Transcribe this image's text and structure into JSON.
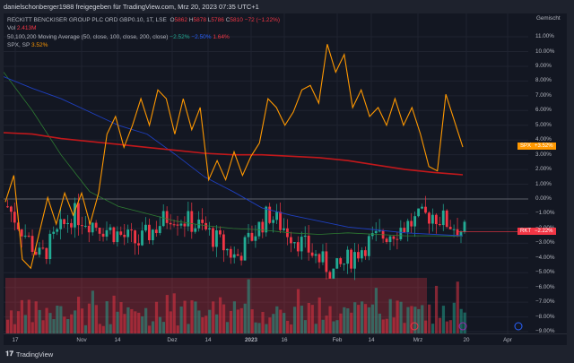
{
  "header": {
    "share_text": "danielschonberger1988 freigegeben für TradingView.com, Mrz 20, 2023 07:35 UTC+1"
  },
  "legend": {
    "symbol": "RECKITT BENCKISER GROUP PLC ORD GBP0.10, 1T, LSE",
    "o_label": "O",
    "o": "5862",
    "h_label": "H",
    "h": "5878",
    "l_label": "L",
    "l": "5786",
    "c_label": "C",
    "c": "5810",
    "change": "−72 (−1.22%)",
    "vol_label": "Vol",
    "vol": "2.413M",
    "ma_label": "50,100,200 Moving Average (50, close, 100, close, 200, close)",
    "ma50": "−2.52%",
    "ma100": "−2.50%",
    "ma200": "1.64%",
    "spx_label": "SPX, SP",
    "spx": "3.52%"
  },
  "scale_label": "Gemischt",
  "y_ticks": [
    "11.00%",
    "10.00%",
    "9.00%",
    "8.00%",
    "7.00%",
    "6.00%",
    "5.00%",
    "4.00%",
    "3.00%",
    "2.00%",
    "1.00%",
    "0.00%",
    "−1.00%",
    "−2.00%",
    "−3.00%",
    "−4.00%",
    "−5.00%",
    "−6.00%",
    "−7.00%",
    "−8.00%",
    "−9.00%"
  ],
  "x_ticks": [
    "17",
    "Nov",
    "14",
    "Dez",
    "14",
    "2023",
    "16",
    "Feb",
    "14",
    "Mrz",
    "20",
    "Apr"
  ],
  "tags": {
    "spx_sym": "SPX",
    "spx_val": "+3.52%",
    "rkt_sym": "RKT",
    "rkt_val": "−2.22%"
  },
  "colors": {
    "up": "#22ab94",
    "down": "#f23645",
    "spx": "#ff9800",
    "ma200": "#c2181b",
    "ma100": "#1e3fbf",
    "ma50": "#2e7d32"
  },
  "chart_data": {
    "type": "line",
    "spx_pct": [
      -0.2,
      1.6,
      -4.1,
      -4.7,
      -2.3,
      0.1,
      -1.7,
      0.4,
      -1.1,
      0.4,
      -1.7,
      0.4,
      4.4,
      5.6,
      3.5,
      5.0,
      6.8,
      5.0,
      7.4,
      6.8,
      4.4,
      6.8,
      4.7,
      6.2,
      1.3,
      2.6,
      1.3,
      3.2,
      1.6,
      2.9,
      3.8,
      6.8,
      6.2,
      5.0,
      5.9,
      7.4,
      7.7,
      6.5,
      10.5,
      8.6,
      9.8,
      6.2,
      7.4,
      5.6,
      6.2,
      5.0,
      6.8,
      5.0,
      6.2,
      4.4,
      2.2,
      1.9,
      7.1,
      5.3,
      3.52
    ],
    "ma200_pct": [
      4.5,
      4.4,
      4.1,
      3.9,
      3.7,
      3.5,
      3.3,
      3.1,
      3.0,
      3.0,
      2.9,
      2.8,
      2.6,
      2.3,
      2.0,
      1.8,
      1.64
    ],
    "ma100_pct": [
      8.3,
      7.5,
      6.8,
      5.9,
      5.0,
      4.4,
      3.0,
      1.5,
      0.5,
      -0.6,
      -1.1,
      -1.5,
      -1.9,
      -2.1,
      -2.3,
      -2.4,
      -2.5
    ],
    "ma50_pct": [
      8.6,
      6.0,
      3.0,
      0.5,
      -0.5,
      -1.0,
      -1.5,
      -1.8,
      -2.0,
      -2.1,
      -2.3,
      -2.4,
      -2.3,
      -2.4,
      -2.5,
      -2.5,
      -2.52
    ],
    "rkt_path_pct": [
      -0.5,
      -4,
      -1,
      -2,
      -3,
      -1,
      -2,
      -4,
      -1,
      -3,
      -5,
      -3,
      -2,
      -1,
      -2.22
    ]
  }
}
